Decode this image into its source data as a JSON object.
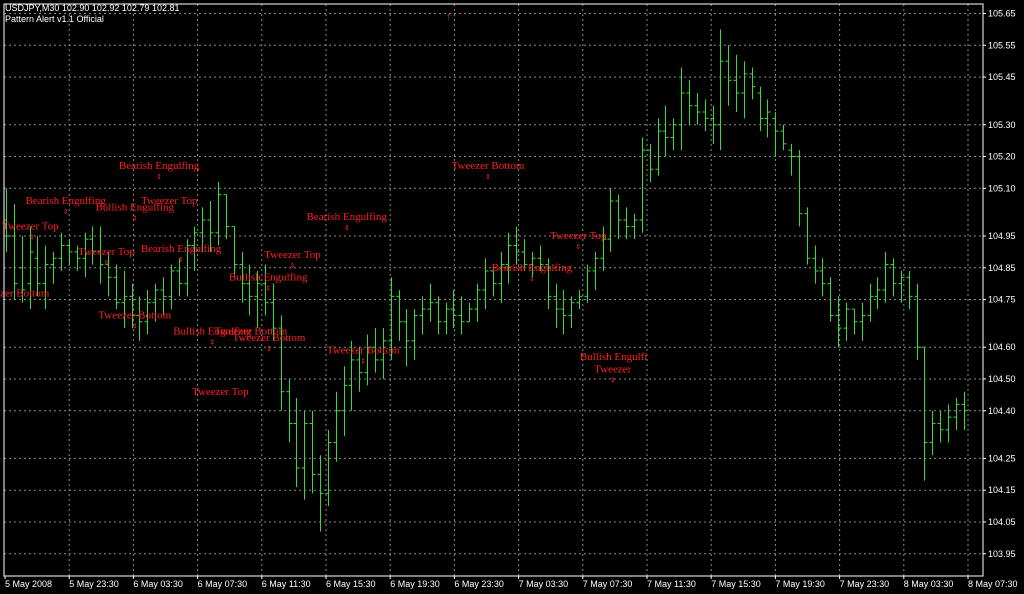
{
  "header": {
    "symbol_line": "USDJPY,M30  102.90 102.92 102.79 102.81",
    "indicator_line": "Pattern Alert v1.1 Official"
  },
  "colors": {
    "background": "#000000",
    "grid": "#8a8a8a",
    "candles": "#33dd33",
    "annotations": "#ff2020",
    "text": "#ffffff"
  },
  "chart_data": {
    "type": "bar",
    "grid": true,
    "ylim": [
      103.88,
      105.68
    ],
    "y_ticks": [
      "105.65",
      "105.55",
      "105.45",
      "105.30",
      "105.20",
      "105.10",
      "104.95",
      "104.85",
      "104.75",
      "104.60",
      "104.50",
      "104.40",
      "104.25",
      "104.15",
      "104.05",
      "103.95"
    ],
    "x_ticks": [
      "5 May 2008",
      "5 May 23:30",
      "6 May 03:30",
      "6 May 07:30",
      "6 May 11:30",
      "6 May 15:30",
      "6 May 19:30",
      "6 May 23:30",
      "7 May 03:30",
      "7 May 07:30",
      "7 May 11:30",
      "7 May 15:30",
      "7 May 19:30",
      "7 May 23:30",
      "8 May 03:30",
      "8 May 07:30"
    ],
    "bars": [
      [
        105.1,
        105.0,
        104.9,
        104.95
      ],
      [
        105.05,
        104.95,
        104.75,
        104.8
      ],
      [
        104.95,
        104.85,
        104.74,
        104.78
      ],
      [
        104.98,
        104.8,
        104.72,
        104.9
      ],
      [
        104.95,
        104.88,
        104.76,
        104.8
      ],
      [
        104.92,
        104.8,
        104.72,
        104.86
      ],
      [
        104.9,
        104.86,
        104.8,
        104.88
      ],
      [
        104.96,
        104.88,
        104.84,
        104.92
      ],
      [
        104.94,
        104.92,
        104.86,
        104.9
      ],
      [
        104.92,
        104.9,
        104.84,
        104.88
      ],
      [
        104.96,
        104.88,
        104.82,
        104.94
      ],
      [
        104.98,
        104.94,
        104.86,
        104.9
      ],
      [
        104.98,
        104.9,
        104.8,
        104.86
      ],
      [
        104.9,
        104.86,
        104.76,
        104.82
      ],
      [
        104.86,
        104.82,
        104.72,
        104.74
      ],
      [
        104.84,
        104.74,
        104.66,
        104.76
      ],
      [
        104.8,
        104.76,
        104.66,
        104.7
      ],
      [
        104.76,
        104.7,
        104.62,
        104.68
      ],
      [
        104.78,
        104.68,
        104.64,
        104.74
      ],
      [
        104.8,
        104.74,
        104.68,
        104.78
      ],
      [
        104.82,
        104.78,
        104.7,
        104.76
      ],
      [
        104.86,
        104.76,
        104.72,
        104.84
      ],
      [
        104.88,
        104.84,
        104.76,
        104.8
      ],
      [
        104.94,
        104.8,
        104.76,
        104.92
      ],
      [
        104.98,
        104.92,
        104.84,
        104.96
      ],
      [
        105.04,
        104.96,
        104.9,
        105.0
      ],
      [
        105.06,
        105.0,
        104.9,
        104.96
      ],
      [
        105.12,
        104.96,
        104.92,
        105.08
      ],
      [
        105.08,
        105.08,
        104.94,
        104.98
      ],
      [
        104.98,
        104.98,
        104.82,
        104.86
      ],
      [
        104.9,
        104.86,
        104.74,
        104.8
      ],
      [
        104.86,
        104.8,
        104.7,
        104.76
      ],
      [
        104.84,
        104.76,
        104.66,
        104.8
      ],
      [
        104.86,
        104.8,
        104.7,
        104.74
      ],
      [
        104.8,
        104.74,
        104.62,
        104.66
      ],
      [
        104.7,
        104.66,
        104.4,
        104.46
      ],
      [
        104.5,
        104.46,
        104.3,
        104.36
      ],
      [
        104.44,
        104.36,
        104.16,
        104.22
      ],
      [
        104.4,
        104.22,
        104.12,
        104.36
      ],
      [
        104.4,
        104.36,
        104.14,
        104.2
      ],
      [
        104.26,
        104.2,
        104.02,
        104.14
      ],
      [
        104.34,
        104.14,
        104.1,
        104.3
      ],
      [
        104.46,
        104.3,
        104.24,
        104.4
      ],
      [
        104.54,
        104.4,
        104.32,
        104.48
      ],
      [
        104.62,
        104.48,
        104.4,
        104.56
      ],
      [
        104.6,
        104.56,
        104.46,
        104.52
      ],
      [
        104.64,
        104.52,
        104.48,
        104.6
      ],
      [
        104.66,
        104.6,
        104.52,
        104.56
      ],
      [
        104.66,
        104.56,
        104.5,
        104.62
      ],
      [
        104.82,
        104.62,
        104.56,
        104.76
      ],
      [
        104.78,
        104.76,
        104.62,
        104.68
      ],
      [
        104.72,
        104.68,
        104.54,
        104.62
      ],
      [
        104.72,
        104.62,
        104.56,
        104.7
      ],
      [
        104.76,
        104.7,
        104.64,
        104.72
      ],
      [
        104.8,
        104.72,
        104.68,
        104.74
      ],
      [
        104.76,
        104.74,
        104.64,
        104.68
      ],
      [
        104.74,
        104.68,
        104.64,
        104.72
      ],
      [
        104.78,
        104.72,
        104.66,
        104.7
      ],
      [
        104.76,
        104.7,
        104.64,
        104.68
      ],
      [
        104.74,
        104.68,
        104.68,
        104.72
      ],
      [
        104.8,
        104.72,
        104.68,
        104.78
      ],
      [
        104.88,
        104.78,
        104.72,
        104.84
      ],
      [
        104.86,
        104.84,
        104.76,
        104.8
      ],
      [
        104.9,
        104.8,
        104.74,
        104.86
      ],
      [
        104.96,
        104.86,
        104.8,
        104.92
      ],
      [
        104.98,
        104.92,
        104.86,
        104.9
      ],
      [
        104.94,
        104.9,
        104.84,
        104.86
      ],
      [
        104.9,
        104.86,
        104.82,
        104.88
      ],
      [
        104.92,
        104.88,
        104.84,
        104.86
      ],
      [
        104.88,
        104.86,
        104.72,
        104.76
      ],
      [
        104.8,
        104.76,
        104.66,
        104.72
      ],
      [
        104.78,
        104.72,
        104.64,
        104.7
      ],
      [
        104.76,
        104.7,
        104.66,
        104.74
      ],
      [
        104.78,
        104.74,
        104.72,
        104.76
      ],
      [
        104.86,
        104.76,
        104.74,
        104.84
      ],
      [
        104.9,
        104.84,
        104.78,
        104.88
      ],
      [
        104.98,
        104.88,
        104.84,
        104.94
      ],
      [
        105.1,
        104.94,
        104.9,
        105.06
      ],
      [
        105.08,
        105.06,
        104.94,
        105.0
      ],
      [
        105.04,
        105.0,
        104.94,
        104.98
      ],
      [
        105.02,
        104.98,
        104.94,
        105.0
      ],
      [
        105.26,
        105.0,
        104.96,
        105.22
      ],
      [
        105.24,
        105.22,
        105.12,
        105.16
      ],
      [
        105.32,
        105.16,
        105.14,
        105.28
      ],
      [
        105.36,
        105.28,
        105.2,
        105.26
      ],
      [
        105.32,
        105.26,
        105.22,
        105.3
      ],
      [
        105.48,
        105.3,
        105.22,
        105.4
      ],
      [
        105.44,
        105.4,
        105.3,
        105.36
      ],
      [
        105.4,
        105.36,
        105.3,
        105.34
      ],
      [
        105.38,
        105.34,
        105.28,
        105.32
      ],
      [
        105.36,
        105.32,
        105.24,
        105.3
      ],
      [
        105.6,
        105.3,
        105.22,
        105.5
      ],
      [
        105.55,
        105.5,
        105.36,
        105.44
      ],
      [
        105.52,
        105.44,
        105.34,
        105.4
      ],
      [
        105.5,
        105.4,
        105.32,
        105.46
      ],
      [
        105.48,
        105.46,
        105.38,
        105.42
      ],
      [
        105.42,
        105.4,
        105.28,
        105.32
      ],
      [
        105.38,
        105.32,
        105.26,
        105.34
      ],
      [
        105.34,
        105.32,
        105.2,
        105.28
      ],
      [
        105.3,
        105.28,
        105.22,
        105.24
      ],
      [
        105.24,
        105.22,
        105.14,
        105.2
      ],
      [
        105.22,
        105.2,
        104.98,
        105.02
      ],
      [
        105.04,
        105.02,
        104.86,
        104.88
      ],
      [
        104.92,
        104.88,
        104.8,
        104.84
      ],
      [
        104.88,
        104.84,
        104.76,
        104.8
      ],
      [
        104.82,
        104.8,
        104.68,
        104.7
      ],
      [
        104.76,
        104.7,
        104.6,
        104.66
      ],
      [
        104.74,
        104.66,
        104.62,
        104.72
      ],
      [
        104.72,
        104.72,
        104.64,
        104.68
      ],
      [
        104.74,
        104.68,
        104.62,
        104.7
      ],
      [
        104.8,
        104.7,
        104.68,
        104.76
      ],
      [
        104.82,
        104.76,
        104.72,
        104.78
      ],
      [
        104.9,
        104.78,
        104.74,
        104.86
      ],
      [
        104.88,
        104.86,
        104.76,
        104.8
      ],
      [
        104.84,
        104.8,
        104.74,
        104.82
      ],
      [
        104.84,
        104.82,
        104.72,
        104.76
      ],
      [
        104.8,
        104.76,
        104.56,
        104.6
      ],
      [
        104.6,
        104.6,
        104.18,
        104.3
      ],
      [
        104.4,
        104.3,
        104.26,
        104.36
      ],
      [
        104.4,
        104.36,
        104.3,
        104.34
      ],
      [
        104.42,
        104.34,
        104.3,
        104.38
      ],
      [
        104.44,
        104.38,
        104.34,
        104.42
      ],
      [
        104.46,
        104.42,
        104.34,
        104.4
      ]
    ],
    "annotations": [
      {
        "text": "Tweezer Top",
        "x": -0.5,
        "price": 104.97,
        "anchor": "start",
        "marker": true
      },
      {
        "text": "eezer Bottom",
        "x": -2,
        "price": 104.76,
        "anchor": "start",
        "marker": false
      },
      {
        "text": "Bearish Engulfing",
        "x": 7.6,
        "price": 105.05,
        "anchor": "middle",
        "marker": true
      },
      {
        "text": "Tweezer Top",
        "x": 12.8,
        "price": 104.89,
        "anchor": "middle",
        "marker": true
      },
      {
        "text": "Bearish Engulfing",
        "x": 19.5,
        "price": 105.16,
        "anchor": "middle",
        "marker": true
      },
      {
        "text": "Bullish Engulfing",
        "x": 16.4,
        "price": 105.03,
        "anchor": "middle",
        "marker": true
      },
      {
        "text": "Tweezer Top",
        "x": 20.8,
        "price": 105.05,
        "anchor": "middle",
        "marker": false
      },
      {
        "text": "Tweezer Bottom",
        "x": 16.4,
        "price": 104.69,
        "anchor": "middle",
        "marker": true
      },
      {
        "text": "Bearish Engulfing",
        "x": 22.3,
        "price": 104.9,
        "anchor": "middle",
        "marker": true
      },
      {
        "text": "Tweezer Top",
        "x": 27.3,
        "price": 104.45,
        "anchor": "middle",
        "marker": false
      },
      {
        "text": "Bullish Engulfing",
        "x": 26.3,
        "price": 104.64,
        "anchor": "middle",
        "marker": true
      },
      {
        "text": "Tweezer Bottom",
        "x": 31.2,
        "price": 104.64,
        "anchor": "middle",
        "marker": false
      },
      {
        "text": "Tweezer Bottom",
        "x": 33.5,
        "price": 104.62,
        "anchor": "middle",
        "marker": true
      },
      {
        "text": "Bullish Engulfing",
        "x": 33.4,
        "price": 104.81,
        "anchor": "middle",
        "marker": true
      },
      {
        "text": "Tweezer Top",
        "x": 36.5,
        "price": 104.88,
        "anchor": "middle",
        "marker": true
      },
      {
        "text": "Bearish Engulfing",
        "x": 43.4,
        "price": 105.0,
        "anchor": "middle",
        "marker": true
      },
      {
        "text": "Tweezer Bottom",
        "x": 45.5,
        "price": 104.58,
        "anchor": "middle",
        "marker": true
      },
      {
        "text": "Tweezer Bottom",
        "x": 61.4,
        "price": 105.16,
        "anchor": "middle",
        "marker": true
      },
      {
        "text": "Bearish Engulfing",
        "x": 67.0,
        "price": 104.84,
        "anchor": "middle",
        "marker": true
      },
      {
        "text": "Tweezer Top",
        "x": 72.9,
        "price": 104.94,
        "anchor": "middle",
        "marker": true
      },
      {
        "text": "Bullish Engulfi",
        "x": 77.4,
        "price": 104.56,
        "anchor": "middle",
        "marker": false
      },
      {
        "text": "Tweezer",
        "x": 77.3,
        "price": 104.52,
        "anchor": "middle",
        "marker": true
      },
      {
        "text": "↑",
        "x": 56.4,
        "price": 105.63,
        "anchor": "middle",
        "marker": false
      }
    ]
  }
}
